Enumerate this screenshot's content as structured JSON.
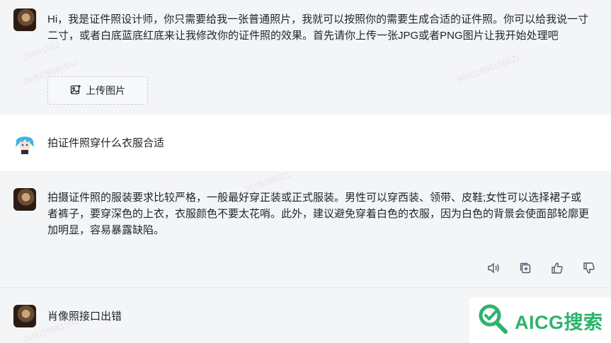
{
  "messages": [
    {
      "role": "bot",
      "text": "Hi，我是证件照设计师，你只需要给我一张普通照片，我就可以按照你的需要生成合适的证件照。你可以给我说一寸二寸，或者白底蓝底红底来让我修改你的证件照的效果。首先请你上传一张JPG或者PNG图片让我开始处理吧",
      "button_label": "上传图片"
    },
    {
      "role": "user",
      "text": "拍证件照穿什么衣服合适"
    },
    {
      "role": "bot",
      "text": "拍摄证件照的服装要求比较严格，一般最好穿正装或正式服装。男性可以穿西装、领带、皮鞋;女性可以选择裙子或者裤子，要穿深色的上衣，衣服颜色不要太花哨。此外，建议避免穿着白色的衣服，因为白色的背景会使面部轮廓更加明显，容易暴露缺陷。"
    },
    {
      "role": "bot",
      "text": "肖像照接口出错"
    }
  ],
  "actions": {
    "icons": [
      "speaker-icon",
      "copy-icon",
      "thumbs-up-icon",
      "thumbs-down-icon"
    ]
  },
  "watermarks": {
    "text_a": "26581552",
    "text_b": "360U26581552",
    "text_c": "360U2658155521",
    "text_d": "2658155521",
    "text_e": "360U26581552"
  },
  "logo": {
    "text": "AICG搜索",
    "color": "#2cb36b"
  },
  "colors": {
    "background": "#f4f5f7",
    "user_background": "#ffffff",
    "text": "#1f2329"
  }
}
